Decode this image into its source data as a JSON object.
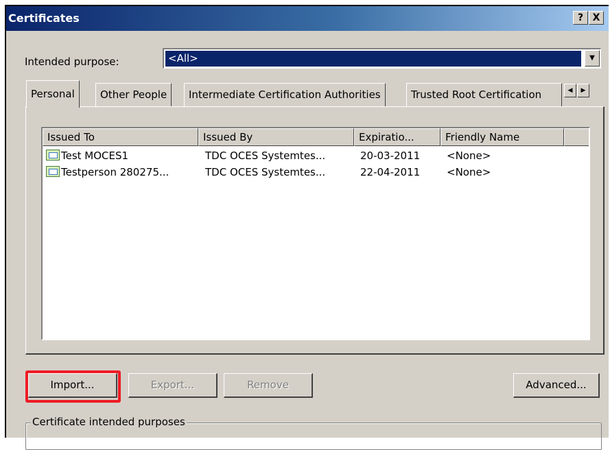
{
  "window": {
    "title": "Certificates",
    "help_button": "?",
    "close_button": "X"
  },
  "purpose": {
    "label": "Intended purpose:",
    "value": "<All>"
  },
  "tabs": [
    {
      "label": "Personal",
      "active": true
    },
    {
      "label": "Other People",
      "active": false
    },
    {
      "label": "Intermediate Certification Authorities",
      "active": false
    },
    {
      "label": "Trusted Root Certification",
      "active": false
    }
  ],
  "table": {
    "columns": [
      "Issued To",
      "Issued By",
      "Expiratio...",
      "Friendly Name"
    ],
    "rows": [
      {
        "issued_to": "Test MOCES1",
        "issued_by": "TDC OCES Systemtes...",
        "expiration": "20-03-2011",
        "friendly_name": "<None>",
        "icon": "certificate-icon"
      },
      {
        "issued_to": "Testperson 280275...",
        "issued_by": "TDC OCES Systemtes...",
        "expiration": "22-04-2011",
        "friendly_name": "<None>",
        "icon": "certificate-icon"
      }
    ]
  },
  "buttons": {
    "import": "Import...",
    "export": "Export...",
    "remove": "Remove",
    "advanced": "Advanced..."
  },
  "group": {
    "legend": "Certificate intended purposes"
  },
  "colors": {
    "highlight": "#ee1c25",
    "title_start": "#0a246a",
    "face": "#d4d0c8"
  }
}
